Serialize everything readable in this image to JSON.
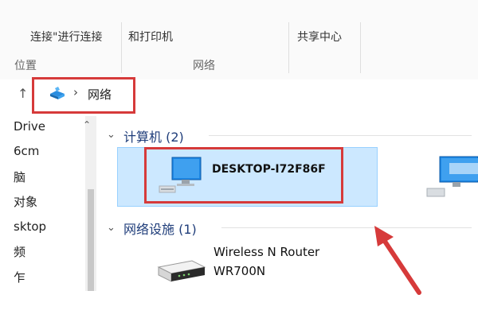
{
  "ribbon": {
    "item_connect": "连接\"进行连接",
    "item_printers": "和打印机",
    "item_sharing": "共享中心",
    "group_location": "位置",
    "group_network": "网络"
  },
  "address": {
    "crumb_label": "网络",
    "separator": "›",
    "up_glyph": "↑"
  },
  "nav": {
    "items": [
      "Drive",
      "6cm",
      "脑",
      "对象",
      "sktop",
      "频",
      "乍"
    ]
  },
  "content": {
    "computers": {
      "header": "计算机 (2)",
      "items": [
        {
          "name": "DESKTOP-I72F86F",
          "icon": "computer-icon"
        }
      ]
    },
    "infrastructure": {
      "header": "网络设施 (1)",
      "items": [
        {
          "name_line1": "Wireless N Router",
          "name_line2": "WR700N",
          "icon": "router-icon"
        }
      ]
    }
  },
  "colors": {
    "annotation_red": "#d63a3a",
    "selection_fill": "#cce8ff",
    "group_header": "#1f3d7a"
  }
}
